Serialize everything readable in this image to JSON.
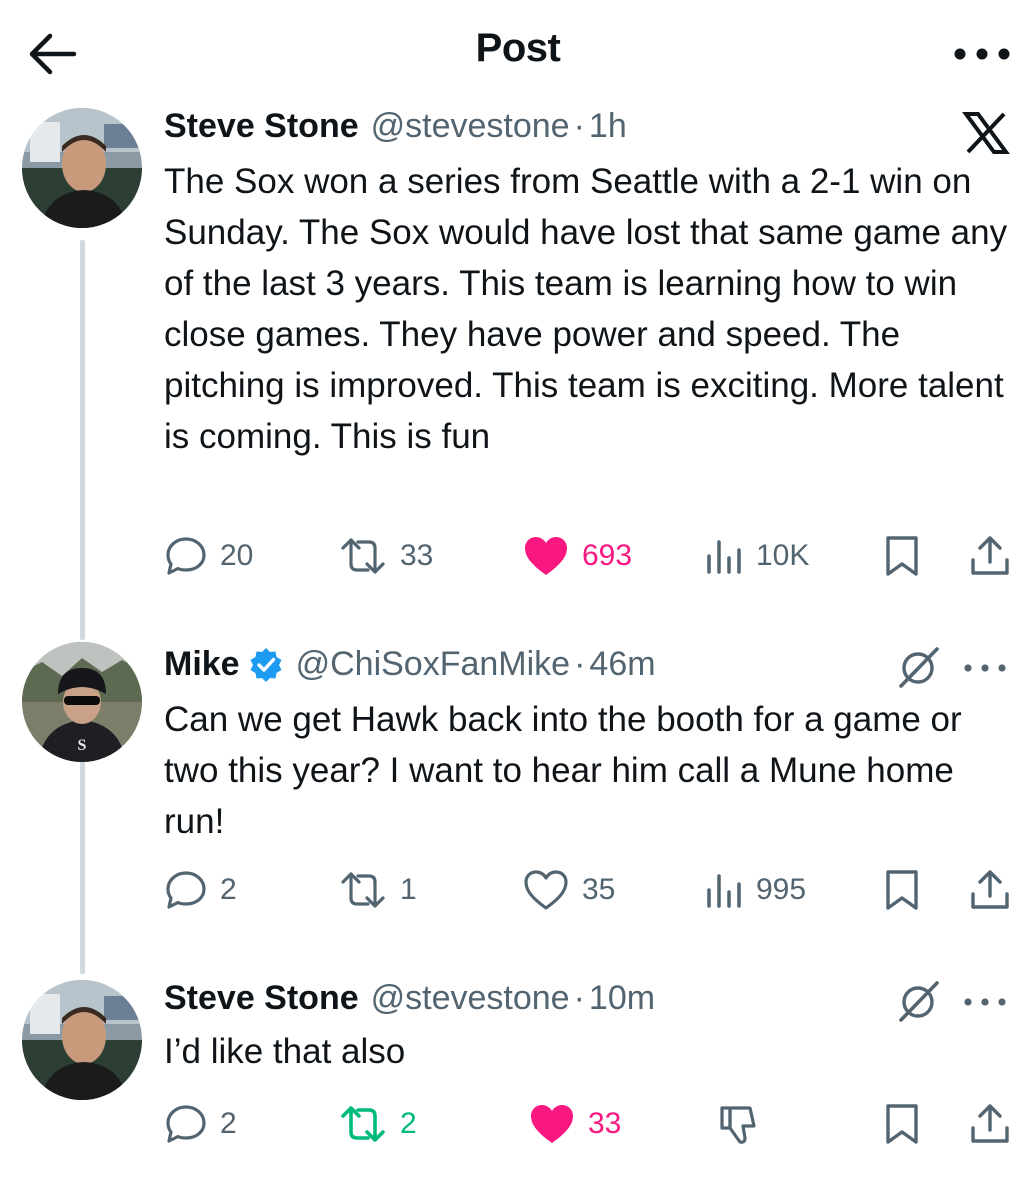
{
  "header": {
    "title": "Post"
  },
  "tweets": [
    {
      "name": "Steve Stone",
      "handle": "@stevestone",
      "time": "1h",
      "text": "The Sox won a series from Seattle with a 2-1 win on Sunday. The Sox would have lost that same game any of the last 3 years. This team is learning how to win close games. They have power and speed. The pitching is improved. This team is exciting. More talent is coming. This is fun",
      "replies": "20",
      "reposts": "33",
      "likes": "693",
      "views": "10K",
      "liked": true
    },
    {
      "name": "Mike",
      "handle": "@ChiSoxFanMike",
      "time": "46m",
      "verified": true,
      "text": "Can we get Hawk back into the booth for a game or two this year? I want to hear him call a Mune home run!",
      "replies": "2",
      "reposts": "1",
      "likes": "35",
      "views": "995",
      "liked": false
    },
    {
      "name": "Steve Stone",
      "handle": "@stevestone",
      "time": "10m",
      "text": "I’d like that also",
      "replies": "2",
      "reposts": "2",
      "likes": "33",
      "liked": true,
      "reposted": true
    }
  ],
  "colors": {
    "like": "#f91880",
    "repost": "#00ba7c",
    "verified": "#1d9bf0",
    "muted": "#536471"
  },
  "icons": [
    "back-arrow-icon",
    "more-icon",
    "x-logo-icon",
    "grok-icon",
    "reply-icon",
    "repost-icon",
    "heart-icon",
    "views-icon",
    "bookmark-icon",
    "share-icon",
    "dislike-icon"
  ]
}
